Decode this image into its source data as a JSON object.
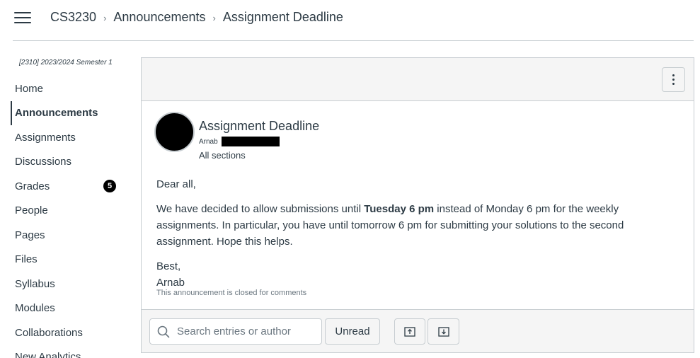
{
  "header": {
    "breadcrumb": {
      "course": "CS3230",
      "section": "Announcements",
      "current": "Assignment Deadline"
    }
  },
  "sidebar": {
    "term": "[2310] 2023/2024 Semester 1",
    "items": [
      {
        "label": "Home"
      },
      {
        "label": "Announcements",
        "active": true
      },
      {
        "label": "Assignments"
      },
      {
        "label": "Discussions"
      },
      {
        "label": "Grades",
        "badge": "5"
      },
      {
        "label": "People"
      },
      {
        "label": "Pages"
      },
      {
        "label": "Files"
      },
      {
        "label": "Syllabus"
      },
      {
        "label": "Modules"
      },
      {
        "label": "Collaborations"
      },
      {
        "label": "New Analytics"
      }
    ]
  },
  "post": {
    "title": "Assignment Deadline",
    "author": "Arnab",
    "sections": "All sections",
    "greeting": "Dear all,",
    "body_part1": "We have decided to allow submissions until ",
    "body_bold": "Tuesday 6 pm",
    "body_part2": " instead of Monday 6 pm for the weekly assignments. In particular, you have until tomorrow 6 pm for submitting your solutions to the second assignment. Hope this helps.",
    "signoff": "Best,",
    "signature": "Arnab",
    "closed_note": "This announcement is closed for comments"
  },
  "toolbar": {
    "search_placeholder": "Search entries or author",
    "unread_label": "Unread"
  },
  "colors": {
    "text": "#2d3b45",
    "border": "#c7cdd1",
    "panel_bg": "#f5f5f5",
    "badge_bg": "#000000"
  }
}
